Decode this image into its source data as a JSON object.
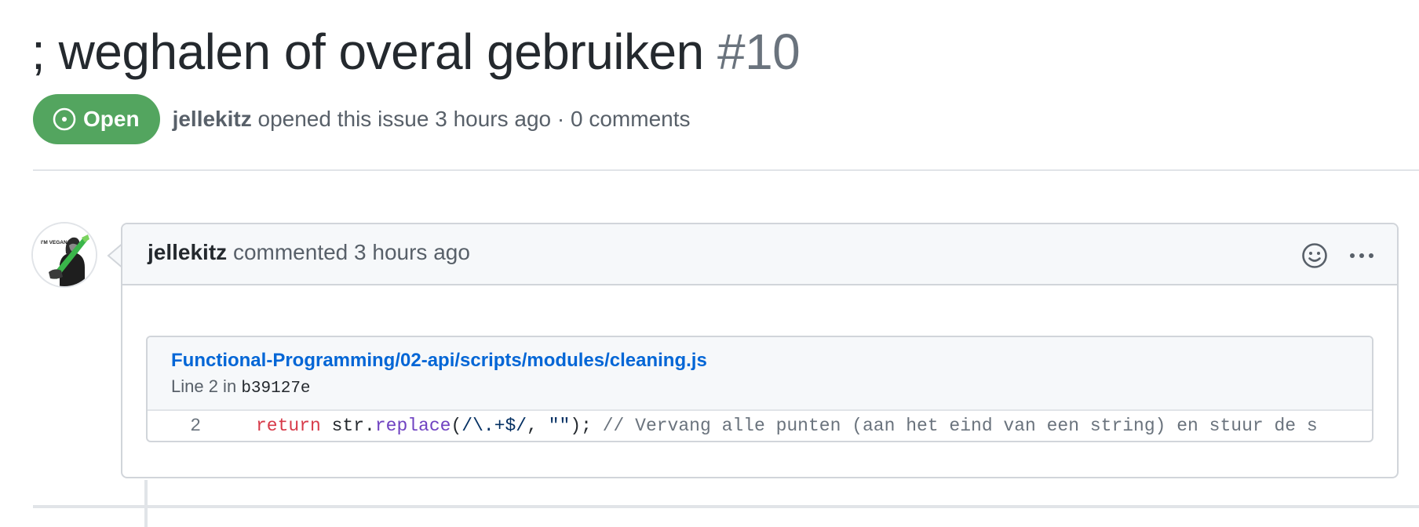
{
  "issue": {
    "title": "; weghalen of overal gebruiken",
    "number": "#10",
    "state": "Open",
    "state_color": "#53a55f",
    "state_icon": "issue-opened-icon",
    "author": "jellekitz",
    "opened_text": "opened this issue 3 hours ago · 0 comments"
  },
  "comment": {
    "author": "jellekitz",
    "action_text": "commented 3 hours ago",
    "avatar_caption": "I'M VEGAN.",
    "actions": [
      "smiley-icon",
      "kebab-horizontal-icon"
    ],
    "snippet": {
      "file_path": "Functional-Programming/02-api/scripts/modules/cleaning.js",
      "line_label": "Line 2 in",
      "commit": "b39127e",
      "line_number": "2",
      "code": {
        "keyword": "return",
        "obj": " str.",
        "method": "replace",
        "open": "(",
        "regex": "/\\.+$/",
        "comma": ", ",
        "string": "\"\"",
        "close": ");",
        "comment": " // Vervang alle punten (aan het eind van een string) en stuur de s"
      }
    }
  }
}
